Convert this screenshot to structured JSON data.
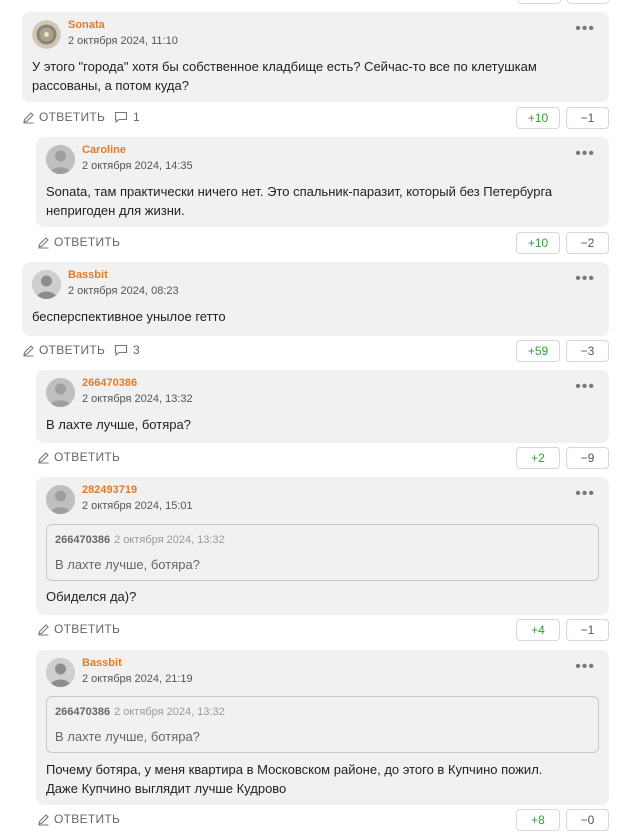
{
  "comments": [
    {
      "author": "Sonata",
      "date": "2 октября 2024, 11:10",
      "text_lines": [
        "У этого \"города\" хотя бы собственное кладбище есть? Сейчас-то все по клетушкам",
        "рассованы, а потом куда?"
      ],
      "reply_label": "ОТВЕТИТЬ",
      "replies_count": "1",
      "upvotes": "+10",
      "downvotes": "−1"
    },
    {
      "author": "Caroline",
      "date": "2 октября 2024, 14:35",
      "text_lines": [
        "Sonata, там практически ничего нет. Это спальник-паразит, который без Петербурга",
        "непригоден для жизни."
      ],
      "reply_label": "ОТВЕТИТЬ",
      "upvotes": "+10",
      "downvotes": "−2"
    },
    {
      "author": "Bassbit",
      "date": "2 октября 2024, 08:23",
      "text_lines": [
        "бесперспективное унылое гетто"
      ],
      "reply_label": "ОТВЕТИТЬ",
      "replies_count": "3",
      "upvotes": "+59",
      "downvotes": "−3"
    },
    {
      "author": "266470386",
      "date": "2 октября 2024, 13:32",
      "text_lines": [
        "В лахте лучше, ботяра?"
      ],
      "reply_label": "ОТВЕТИТЬ",
      "upvotes": "+2",
      "downvotes": "−9"
    },
    {
      "author": "282493719",
      "date": "2 октября 2024, 15:01",
      "quote": {
        "author": "266470386",
        "date": "2 октября 2024, 13:32",
        "text": "В лахте лучше, ботяра?"
      },
      "text_lines": [
        "Обиделся да)?"
      ],
      "reply_label": "ОТВЕТИТЬ",
      "upvotes": "+4",
      "downvotes": "−1"
    },
    {
      "author": "Bassbit",
      "date": "2 октября 2024, 21:19",
      "quote": {
        "author": "266470386",
        "date": "2 октября 2024, 13:32",
        "text": "В лахте лучше, ботяра?"
      },
      "text_lines": [
        "Почему ботяра, у меня квартира в Московском районе, до этого в Купчино пожил.",
        "Даже Купчино выглядит лучше Кудрово"
      ],
      "reply_label": "ОТВЕТИТЬ",
      "upvotes": "+8",
      "downvotes": "−0"
    }
  ],
  "menu_glyph": "•••",
  "colors": {
    "author": "#e07b2a",
    "card_bg": "#f1f1f1",
    "upvote": "#3a9a3a"
  }
}
